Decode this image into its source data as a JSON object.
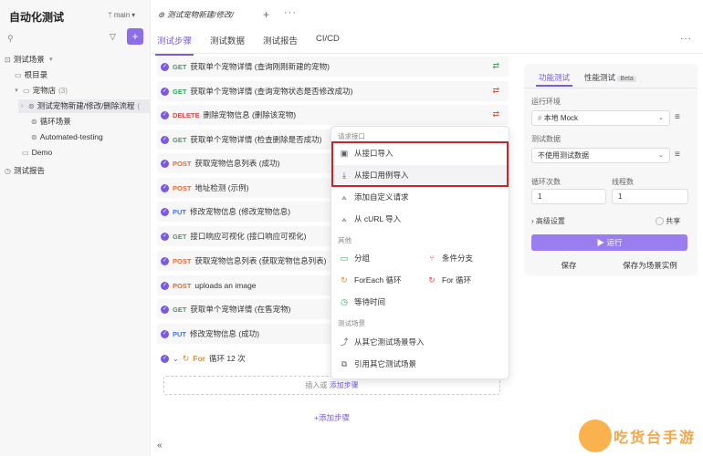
{
  "sidebar": {
    "app_title": "自动化测试",
    "branch": "main",
    "tree": [
      {
        "label": "测试场景",
        "count": ""
      },
      {
        "label": "根目录",
        "count": ""
      },
      {
        "label": "宠物店",
        "count": "(3)"
      },
      {
        "label": "测试宠物新建/修改/删除流程",
        "count": "("
      },
      {
        "label": "循环场景",
        "count": ""
      },
      {
        "label": "Automated-testing",
        "count": ""
      },
      {
        "label": "Demo",
        "count": ""
      },
      {
        "label": "测试报告",
        "count": ""
      }
    ]
  },
  "header": {
    "doc_tab": "测试宠物新建/修改/",
    "tabs": [
      "测试步骤",
      "测试数据",
      "测试报告",
      "CI/CD"
    ]
  },
  "steps": [
    {
      "method": "GET",
      "text": "获取单个宠物详情 (查询刚刚新建的宠物)"
    },
    {
      "method": "GET",
      "text": "获取单个宠物详情 (查询宠物状态是否修改成功)"
    },
    {
      "method": "DELETE",
      "text": "删除宠物信息 (删除该宠物)"
    },
    {
      "method": "GET",
      "text": "获取单个宠物详情 (检查删除是否成功)"
    },
    {
      "method": "POST",
      "text": "获取宠物信息列表 (成功)"
    },
    {
      "method": "POST",
      "text": "地址检测 (示例)"
    },
    {
      "method": "PUT",
      "text": "修改宠物信息 (修改宠物信息)"
    },
    {
      "method": "GET",
      "text": "接口响应可视化 (接口响应可视化)"
    },
    {
      "method": "POST",
      "text": "获取宠物信息列表 (获取宠物信息列表)"
    },
    {
      "method": "POST",
      "text": "uploads an image"
    },
    {
      "method": "GET",
      "text": "获取单个宠物详情 (在售宠物)"
    },
    {
      "method": "PUT",
      "text": "修改宠物信息 (成功)"
    }
  ],
  "loop_step": {
    "keyword": "For",
    "text": "循环 12 次"
  },
  "insert": {
    "prefix": "插入或",
    "link": "添加步骤"
  },
  "add_step": "添加步骤",
  "menu": {
    "group_api": "请求接口",
    "import_api": "从接口导入",
    "import_case": "从接口用例导入",
    "add_custom": "添加自定义请求",
    "import_curl": "从 cURL 导入",
    "group_other": "其他",
    "group": "分组",
    "branch": "条件分支",
    "foreach": "ForEach 循环",
    "for_loop": "For 循环",
    "wait": "等待时间",
    "group_scene": "测试场景",
    "import_scene": "从其它测试场景导入",
    "ref_scene": "引用其它测试场景"
  },
  "panel": {
    "tab_func": "功能测试",
    "tab_perf": "性能测试",
    "beta": "Beta",
    "env_label": "运行环境",
    "env_value": "本地 Mock",
    "data_label": "测试数据",
    "data_value": "不使用测试数据",
    "loop_label": "循环次数",
    "loop_value": "1",
    "thread_label": "线程数",
    "thread_value": "1",
    "advanced": "高级设置",
    "share": "共享",
    "run": "运行",
    "save": "保存",
    "save_as": "保存为场景实例"
  },
  "watermark": "吃货台手游",
  "colors": {
    "accent": "#7a5be0",
    "highlight_border": "#c8262e"
  }
}
